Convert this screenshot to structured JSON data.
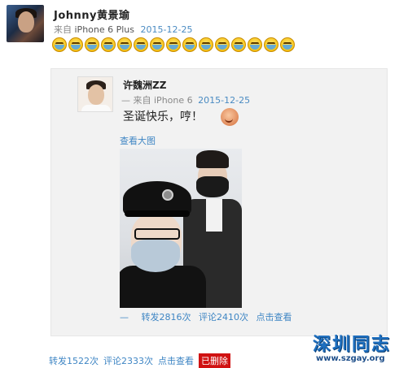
{
  "post": {
    "username": "Johnny黄景瑜",
    "via_prefix": "来自",
    "via": "iPhone 6 Plus",
    "date": "2015-12-25",
    "emoji_count": 15,
    "emoji_icon": "crying-laughing-emoji"
  },
  "repost": {
    "username": "许魏洲ZZ",
    "via_prefix": "— 来自",
    "via": "iPhone 6",
    "date": "2015-12-25",
    "text": "圣诞快乐，哼！",
    "sticker_icon": "pouting-sticker-emoji",
    "view_large": "查看大图",
    "actions": {
      "dash": "—",
      "repost": "转发2816次",
      "comment": "评论2410次",
      "view": "点击查看"
    }
  },
  "actions": {
    "repost": "转发1522次",
    "comment": "评论2333次",
    "view": "点击查看",
    "deleted": "已删除"
  },
  "watermark": {
    "title": "深圳同志",
    "url": "www.szgay.org"
  },
  "colors": {
    "link": "#3f86c4",
    "deleted_bg": "#d01212",
    "repost_bg": "#f2f2f2"
  }
}
